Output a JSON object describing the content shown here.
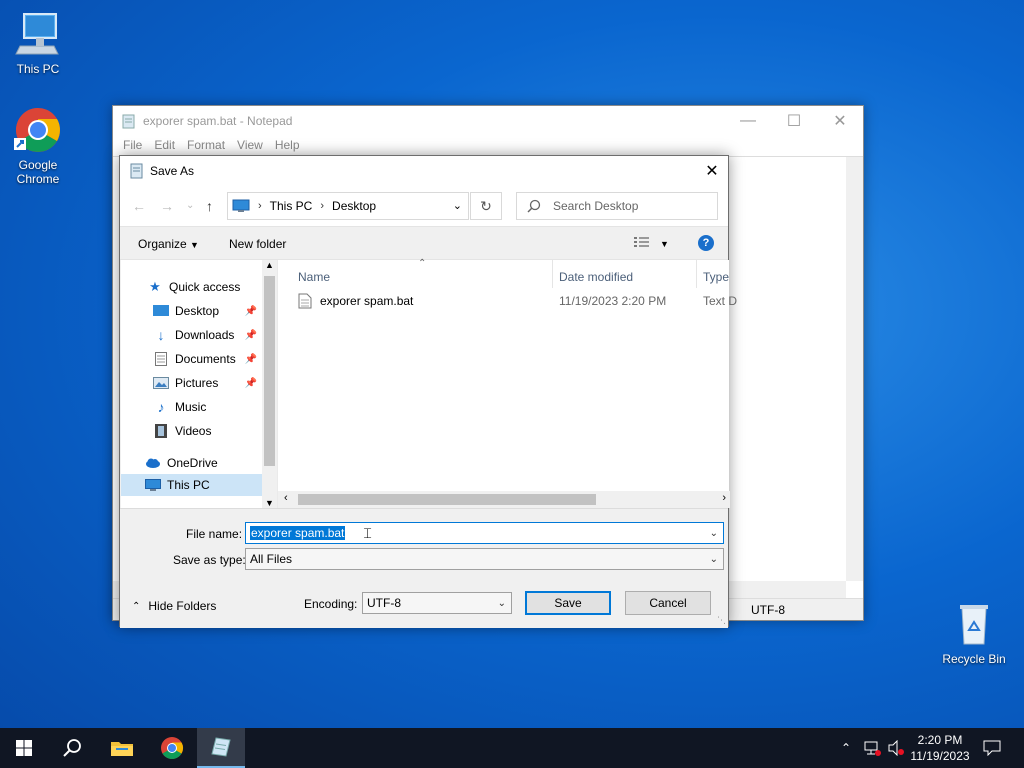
{
  "desktop": {
    "icons": [
      {
        "label": "This PC"
      },
      {
        "label": "Google Chrome"
      },
      {
        "label": "Recycle Bin"
      }
    ]
  },
  "notepad": {
    "title": "exporer spam.bat - Notepad",
    "menu": [
      "File",
      "Edit",
      "Format",
      "View",
      "Help"
    ],
    "status_encoding": "UTF-8"
  },
  "save_dialog": {
    "title": "Save As",
    "address": {
      "parts": [
        "This PC",
        "Desktop"
      ]
    },
    "search_placeholder": "Search Desktop",
    "toolbar": {
      "organize": "Organize",
      "new_folder": "New folder"
    },
    "nav": {
      "quick_access": "Quick access",
      "items": [
        "Desktop",
        "Downloads",
        "Documents",
        "Pictures",
        "Music",
        "Videos"
      ],
      "onedrive": "OneDrive",
      "this_pc": "This PC"
    },
    "columns": {
      "name": "Name",
      "date": "Date modified",
      "type": "Type"
    },
    "files": [
      {
        "name": "exporer spam.bat",
        "date": "11/19/2023 2:20 PM",
        "type": "Text D"
      }
    ],
    "file_name_label": "File name:",
    "file_name_value": "exporer spam.bat",
    "save_type_label": "Save as type:",
    "save_type_value": "All Files",
    "hide_folders": "Hide Folders",
    "encoding_label": "Encoding:",
    "encoding_value": "UTF-8",
    "save_button": "Save",
    "cancel_button": "Cancel"
  },
  "taskbar": {
    "time": "2:20 PM",
    "date": "11/19/2023"
  },
  "colors": {
    "accent": "#0078d7",
    "taskbar": "#101623",
    "selection": "#cce4f7"
  }
}
